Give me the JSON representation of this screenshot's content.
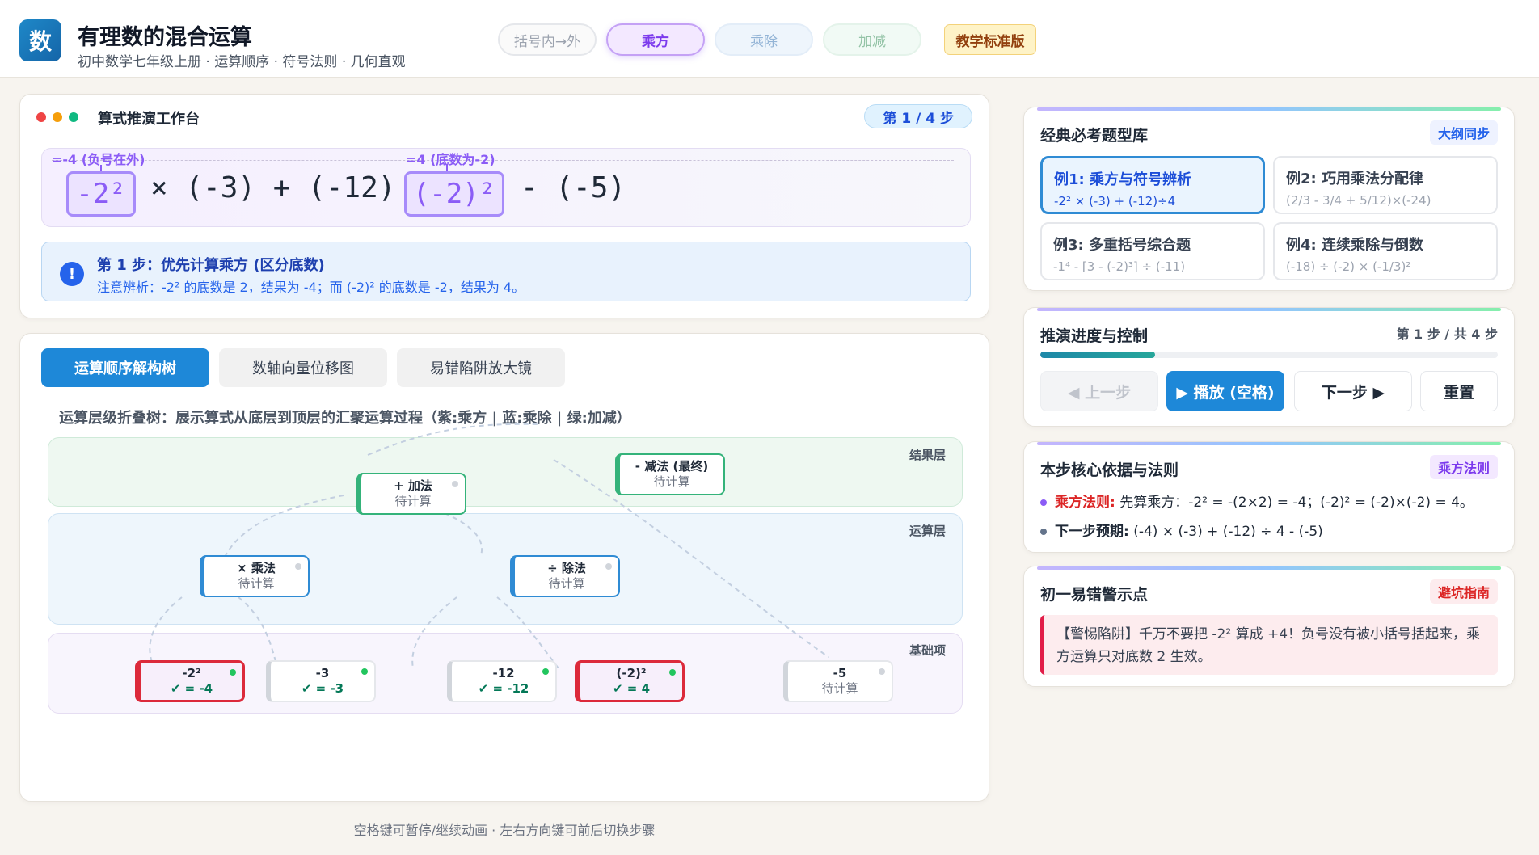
{
  "header": {
    "logo": "数",
    "title": "有理数的混合运算",
    "subtitle": "初中数学七年级上册 · 运算顺序 · 符号法则 · 几何直观",
    "phases": [
      "括号内→外",
      "乘方",
      "乘除",
      "加减"
    ],
    "edition": "教学标准版"
  },
  "workbench": {
    "title": "算式推演工作台",
    "step_badge": "第 1 / 4 步",
    "annotations": [
      "=-4 (负号在外)",
      "=4 (底数为-2)"
    ],
    "expression": {
      "term1": "-2²",
      "op1": "× (-3) + (-12) ÷",
      "term2": "(-2)²",
      "op2": "- (-5)"
    },
    "hint": {
      "icon": "!",
      "title": "第 1 步：优先计算乘方 (区分底数)",
      "text": "注意辨析：-2² 的底数是 2，结果为 -4；而 (-2)² 的底数是 -2，结果为 4。"
    }
  },
  "viz": {
    "tabs": [
      "运算顺序解构树",
      "数轴向量位移图",
      "易错陷阱放大镜"
    ],
    "description": "运算层级折叠树：展示算式从底层到顶层的汇聚运算过程（紫:乘方 | 蓝:乘除 | 绿:加减）",
    "layers": [
      "结果层",
      "运算层",
      "基础项"
    ],
    "nodes": {
      "add": {
        "op": "+ 加法",
        "st": "待计算"
      },
      "sub": {
        "op": "- 减法 (最终)",
        "st": "待计算"
      },
      "mul": {
        "op": "× 乘法",
        "st": "待计算"
      },
      "div": {
        "op": "÷ 除法",
        "st": "待计算"
      },
      "n1": {
        "op": "-2²",
        "st": "✔ = -4"
      },
      "n2": {
        "op": "-3",
        "st": "✔ = -3"
      },
      "n3": {
        "op": "-12",
        "st": "✔ = -12"
      },
      "n4": {
        "op": "(-2)²",
        "st": "✔ = 4"
      },
      "n5": {
        "op": "-5",
        "st": "待计算"
      }
    }
  },
  "shortcut_hint": "空格键可暂停/继续动画 · 左右方向键可前后切换步骤",
  "examples": {
    "title": "经典必考题型库",
    "tag": "大纲同步",
    "items": [
      {
        "title": "例1: 乘方与符号辨析",
        "formula": "-2² × (-3) + (-12)÷4"
      },
      {
        "title": "例2: 巧用乘法分配律",
        "formula": "(2/3 - 3/4 + 5/12)×(-24)"
      },
      {
        "title": "例3: 多重括号综合题",
        "formula": "-1⁴ - [3 - (-2)³] ÷ (-11)"
      },
      {
        "title": "例4: 连续乘除与倒数",
        "formula": "(-18) ÷ (-2) × (-1/3)²"
      }
    ]
  },
  "progress": {
    "title": "推演进度与控制",
    "label": "第 1 步 / 共 4 步",
    "fraction": 0.25,
    "prev": "◀ 上一步",
    "play": "▶ 播放 (空格)",
    "next": "下一步 ▶",
    "reset": "重置"
  },
  "rules": {
    "title": "本步核心依据与法则",
    "tag": "乘方法则",
    "items": [
      {
        "key": "乘方法则:",
        "text": "先算乘方：-2² = -(2×2) = -4；(-2)² = (-2)×(-2) = 4。"
      },
      {
        "key": "下一步预期:",
        "text": "(-4) × (-3) + (-12) ÷ 4 - (-5)"
      }
    ]
  },
  "warnings": {
    "title": "初一易错警示点",
    "tag": "避坑指南",
    "text": "【警惕陷阱】千万不要把 -2² 算成 +4！负号没有被小括号括起来，乘方运算只对底数 2 生效。"
  },
  "colors": {
    "accent_blue": "#1e88d8",
    "power_purple": "#8b5cf6",
    "muldiv_blue": "#2f8bd4",
    "addsub_green": "#34b37a",
    "error_red": "#dc2a3b"
  }
}
